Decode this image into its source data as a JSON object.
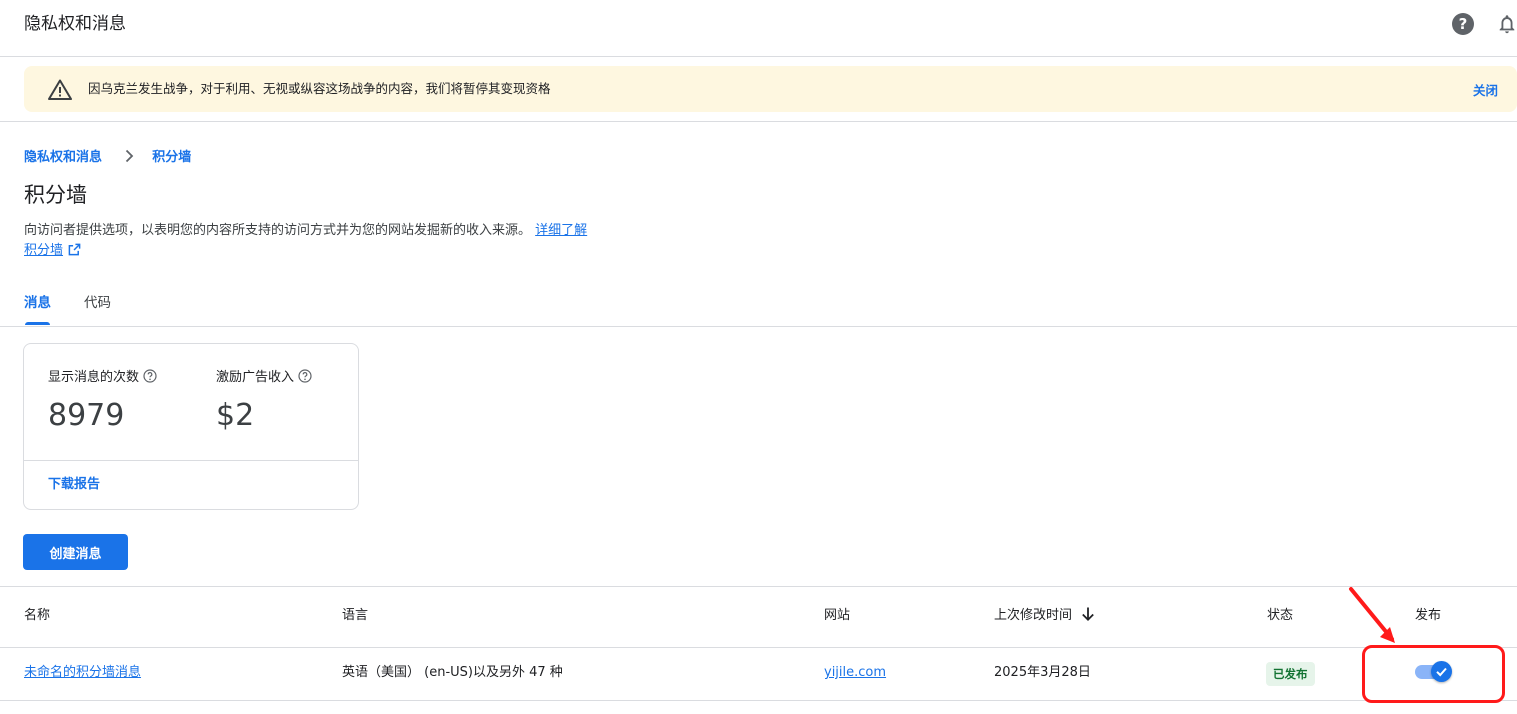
{
  "header": {
    "title": "隐私权和消息",
    "help_icon": "help-circle-icon",
    "notification_icon": "bell-icon"
  },
  "banner": {
    "icon": "warning-triangle-icon",
    "text": "因乌克兰发生战争，对于利用、无视或纵容这场战争的内容，我们将暂停其变现资格",
    "close_label": "关闭",
    "background_color": "#fef7e0"
  },
  "breadcrumb": {
    "items": [
      "隐私权和消息",
      "积分墙"
    ],
    "separator_icon": "chevron-right-icon"
  },
  "page": {
    "title": "积分墙",
    "description": "向访问者提供选项，以表明您的内容所支持的访问方式并为您的网站发掘新的收入来源。",
    "learn_more_label": "详细了解",
    "learn_more_link2": "积分墙",
    "external_icon": "open-in-new-icon"
  },
  "tabs": [
    {
      "label": "消息",
      "active": true
    },
    {
      "label": "代码",
      "active": false
    }
  ],
  "stats": {
    "items": [
      {
        "label": "显示消息的次数",
        "value": "8979"
      },
      {
        "label": "激励广告收入",
        "value": "$2"
      }
    ],
    "download_label": "下载报告"
  },
  "create_button_label": "创建消息",
  "table": {
    "columns": [
      "名称",
      "语言",
      "网站",
      "上次修改时间",
      "状态",
      "发布"
    ],
    "sort_icon": "arrow-down-icon",
    "rows": [
      {
        "name": "未命名的积分墙消息",
        "language": "英语（美国） (en-US)以及另外 47 种",
        "site": "yijile.com",
        "modified": "2025年3月28日",
        "status": "已发布",
        "published": true
      }
    ]
  },
  "colors": {
    "accent": "#1a73e8",
    "status_green": "#137333",
    "annotation_red": "#ff1a1a"
  }
}
